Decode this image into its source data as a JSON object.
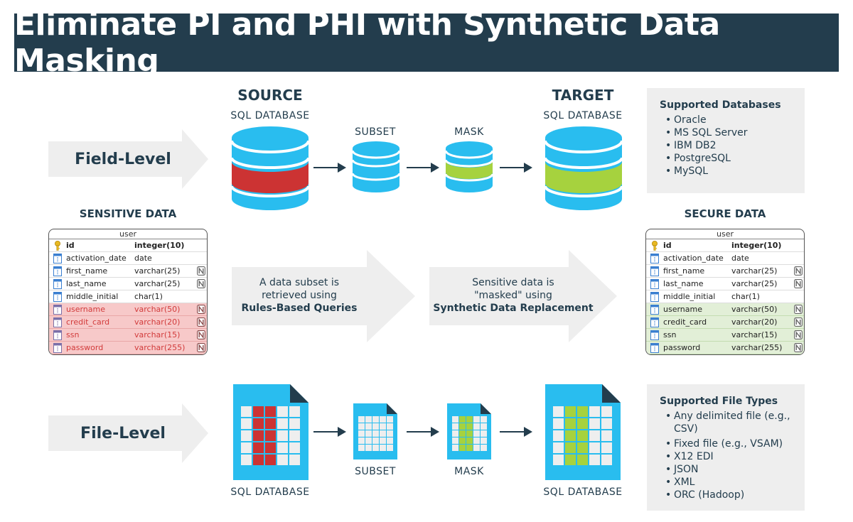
{
  "title": "Eliminate PI and PHI with Synthetic Data Masking",
  "colors": {
    "title_bg": "#233d4d",
    "db_blue": "#29bdef",
    "sensitive_red": "#cc3333",
    "masked_green": "#a6d23e",
    "arrow_gray": "#eeeeee",
    "text_dark": "#233d4d"
  },
  "field_level": {
    "label": "Field-Level",
    "source_heading": "SOURCE",
    "source_sublabel": "SQL DATABASE",
    "subset_label": "SUBSET",
    "mask_label": "MASK",
    "target_heading": "TARGET",
    "target_sublabel": "SQL DATABASE"
  },
  "supported_databases": {
    "title": "Supported Databases",
    "items": [
      "Oracle",
      "MS SQL Server",
      "IBM DB2",
      "PostgreSQL",
      "MySQL"
    ]
  },
  "sensitive_data": {
    "heading": "SENSITIVE DATA",
    "table_name": "user",
    "rows": [
      {
        "name": "id",
        "type": "integer(10)",
        "key": true,
        "nullable": false,
        "highlight": false
      },
      {
        "name": "activation_date",
        "type": "date",
        "key": false,
        "nullable": false,
        "highlight": false
      },
      {
        "name": "first_name",
        "type": "varchar(25)",
        "key": false,
        "nullable": true,
        "highlight": false
      },
      {
        "name": "last_name",
        "type": "varchar(25)",
        "key": false,
        "nullable": true,
        "highlight": false
      },
      {
        "name": "middle_initial",
        "type": "char(1)",
        "key": false,
        "nullable": false,
        "highlight": false
      },
      {
        "name": "username",
        "type": "varchar(50)",
        "key": false,
        "nullable": true,
        "highlight": true
      },
      {
        "name": "credit_card",
        "type": "varchar(20)",
        "key": false,
        "nullable": true,
        "highlight": true
      },
      {
        "name": "ssn",
        "type": "varchar(15)",
        "key": false,
        "nullable": true,
        "highlight": true
      },
      {
        "name": "password",
        "type": "varchar(255)",
        "key": false,
        "nullable": true,
        "highlight": true
      }
    ]
  },
  "secure_data": {
    "heading": "SECURE DATA",
    "table_name": "user",
    "rows": [
      {
        "name": "id",
        "type": "integer(10)",
        "key": true,
        "nullable": false,
        "highlight": false
      },
      {
        "name": "activation_date",
        "type": "date",
        "key": false,
        "nullable": false,
        "highlight": false
      },
      {
        "name": "first_name",
        "type": "varchar(25)",
        "key": false,
        "nullable": true,
        "highlight": false
      },
      {
        "name": "last_name",
        "type": "varchar(25)",
        "key": false,
        "nullable": true,
        "highlight": false
      },
      {
        "name": "middle_initial",
        "type": "char(1)",
        "key": false,
        "nullable": false,
        "highlight": false
      },
      {
        "name": "username",
        "type": "varchar(50)",
        "key": false,
        "nullable": true,
        "highlight": true
      },
      {
        "name": "credit_card",
        "type": "varchar(20)",
        "key": false,
        "nullable": true,
        "highlight": true
      },
      {
        "name": "ssn",
        "type": "varchar(15)",
        "key": false,
        "nullable": true,
        "highlight": true
      },
      {
        "name": "password",
        "type": "varchar(255)",
        "key": false,
        "nullable": true,
        "highlight": true
      }
    ]
  },
  "flow_steps": [
    {
      "line1": "A data subset is",
      "line2": "retrieved using",
      "bold": "Rules-Based Queries"
    },
    {
      "line1": "Sensitive data is",
      "line2": "\"masked\" using",
      "bold": "Synthetic Data Replacement"
    }
  ],
  "file_level": {
    "label": "File-Level",
    "source_label": "SQL DATABASE",
    "subset_label": "SUBSET",
    "mask_label": "MASK",
    "target_label": "SQL DATABASE"
  },
  "supported_file_types": {
    "title": "Supported File Types",
    "items": [
      "Any delimited file (e.g., CSV)",
      "Fixed file (e.g., VSAM)",
      "X12 EDI",
      "JSON",
      "XML",
      "ORC (Hadoop)"
    ]
  }
}
